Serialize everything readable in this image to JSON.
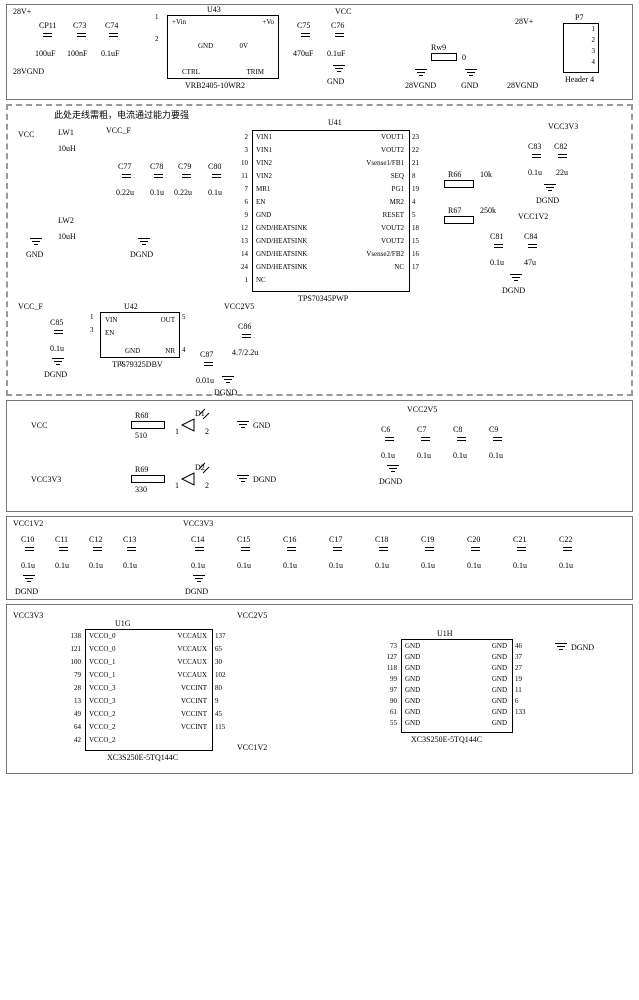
{
  "sec1": {
    "note": "",
    "p28v": "28V+",
    "p28vgnd": "28VGND",
    "cp11": {
      "ref": "CP11",
      "val": "100uF"
    },
    "c73": {
      "ref": "C73",
      "val": "100nF"
    },
    "c74": {
      "ref": "C74",
      "val": "0.1uF"
    },
    "u43": {
      "ref": "U43",
      "pn": "VRB2405-10WR2",
      "pins": {
        "vin": "+Vin",
        "vo": "+Vo",
        "gnd": "GND",
        "zv": "0V",
        "ctrl": "CTRL",
        "trim": "TRIM"
      },
      "num1": "1",
      "num2": "2"
    },
    "vcc": "VCC",
    "c75": {
      "ref": "C75",
      "val": "470uF"
    },
    "c76": {
      "ref": "C76",
      "val": "0.1uF"
    },
    "gnd": "GND",
    "rw9": {
      "ref": "Rw9",
      "val": "0"
    },
    "p7": {
      "ref": "P7",
      "pn": "Header 4",
      "pins": [
        "1",
        "2",
        "3",
        "4"
      ]
    }
  },
  "sec2": {
    "note": "此处走线需粗，电流通过能力要强",
    "vcc": "VCC",
    "vccf": "VCC_F",
    "gnd": "GND",
    "dgnd": "DGND",
    "lw1": {
      "ref": "LW1",
      "val": "10uH"
    },
    "lw2": {
      "ref": "LW2",
      "val": "10uH"
    },
    "c77": {
      "ref": "C77",
      "val": "0.22u"
    },
    "c78": {
      "ref": "C78",
      "val": "0.1u"
    },
    "c79": {
      "ref": "C79",
      "val": "0.22u"
    },
    "c80": {
      "ref": "C80",
      "val": "0.1u"
    },
    "u41": {
      "ref": "U41",
      "pn": "TPS70345PWP",
      "left": [
        "VIN1",
        "VIN1",
        "VIN2",
        "VIN2",
        "MR1",
        "EN",
        "GND",
        "GND/HEATSINK",
        "GND/HEATSINK",
        "GND/HEATSINK",
        "GND/HEATSINK",
        "NC"
      ],
      "lnum": [
        "2",
        "3",
        "10",
        "11",
        "7",
        "6",
        "9",
        "12",
        "13",
        "14",
        "24",
        "1"
      ],
      "right": [
        "VOUT1",
        "VOUT2",
        "Vsense1/FB1",
        "SEQ",
        "PG1",
        "MR2",
        "RESET",
        "VOUT2",
        "VOUT2",
        "Vsense2/FB2",
        "NC"
      ],
      "rnum": [
        "23",
        "22",
        "21",
        "8",
        "19",
        "4",
        "5",
        "18",
        "15",
        "16",
        "17"
      ]
    },
    "r66": {
      "ref": "R66",
      "val": "10k"
    },
    "r67": {
      "ref": "R67",
      "val": "250k"
    },
    "vcc3v3": "VCC3V3",
    "vcc1v2": "VCC1V2",
    "c82": {
      "ref": "C82",
      "val": "22u"
    },
    "c83": {
      "ref": "C83",
      "val": "0.1u"
    },
    "c81": {
      "ref": "C81",
      "val": "0.1u"
    },
    "c84": {
      "ref": "C84",
      "val": "47u"
    },
    "u42": {
      "ref": "U42",
      "pn": "TPS79325DBV",
      "pins": {
        "vin": "VIN",
        "en": "EN",
        "gnd": "GND",
        "out": "OUT",
        "nr": "NR"
      },
      "num": {
        "vin": "1",
        "en": "3",
        "gnd": "2",
        "out": "5",
        "nr": "4"
      }
    },
    "c85": {
      "ref": "C85",
      "val": "0.1u"
    },
    "c86": {
      "ref": "C86",
      "val": "4.7/2.2u"
    },
    "c87": {
      "ref": "C87",
      "val": "0.01u"
    },
    "vcc2v5": "VCC2V5"
  },
  "sec3": {
    "vcc": "VCC",
    "vcc3v3": "VCC3V3",
    "gnd": "GND",
    "dgnd": "DGND",
    "vcc2v5": "VCC2V5",
    "r68": {
      "ref": "R68",
      "val": "510"
    },
    "r69": {
      "ref": "R69",
      "val": "330"
    },
    "d1": {
      "ref": "D1",
      "a": "1",
      "k": "2"
    },
    "d2": {
      "ref": "D2",
      "a": "1",
      "k": "2"
    },
    "c6": {
      "ref": "C6",
      "val": "0.1u"
    },
    "c7": {
      "ref": "C7",
      "val": "0.1u"
    },
    "c8": {
      "ref": "C8",
      "val": "0.1u"
    },
    "c9": {
      "ref": "C9",
      "val": "0.1u"
    }
  },
  "sec4": {
    "vcc1v2": "VCC1V2",
    "vcc3v3": "VCC3V3",
    "dgnd": "DGND",
    "c10": {
      "ref": "C10",
      "val": "0.1u"
    },
    "c11": {
      "ref": "C11",
      "val": "0.1u"
    },
    "c12": {
      "ref": "C12",
      "val": "0.1u"
    },
    "c13": {
      "ref": "C13",
      "val": "0.1u"
    },
    "c14": {
      "ref": "C14",
      "val": "0.1u"
    },
    "c15": {
      "ref": "C15",
      "val": "0.1u"
    },
    "c16": {
      "ref": "C16",
      "val": "0.1u"
    },
    "c17": {
      "ref": "C17",
      "val": "0.1u"
    },
    "c18": {
      "ref": "C18",
      "val": "0.1u"
    },
    "c19": {
      "ref": "C19",
      "val": "0.1u"
    },
    "c20": {
      "ref": "C20",
      "val": "0.1u"
    },
    "c21": {
      "ref": "C21",
      "val": "0.1u"
    },
    "c22": {
      "ref": "C22",
      "val": "0.1u"
    }
  },
  "sec5": {
    "vcc3v3": "VCC3V3",
    "vcc2v5": "VCC2V5",
    "vcc1v2": "VCC1V2",
    "dgnd": "DGND",
    "u1g": {
      "ref": "U1G",
      "pn": "XC3S250E-5TQ144C",
      "left": [
        "VCCO_0",
        "VCCO_0",
        "VCCO_1",
        "VCCO_1",
        "VCCO_3",
        "VCCO_3",
        "VCCO_2",
        "VCCO_2",
        "VCCO_2"
      ],
      "lnum": [
        "138",
        "121",
        "100",
        "79",
        "28",
        "13",
        "49",
        "64",
        "42"
      ],
      "right": [
        "VCCAUX",
        "VCCAUX",
        "VCCAUX",
        "VCCAUX",
        "VCCINT",
        "VCCINT",
        "VCCINT",
        "VCCINT"
      ],
      "rnum": [
        "137",
        "65",
        "30",
        "102",
        "80",
        "9",
        "45",
        "115"
      ]
    },
    "u1h": {
      "ref": "U1H",
      "pn": "XC3S250E-5TQ144C",
      "left": [
        "GND",
        "GND",
        "GND",
        "GND",
        "GND",
        "GND",
        "GND",
        "GND"
      ],
      "lnum": [
        "73",
        "127",
        "118",
        "99",
        "97",
        "90",
        "61",
        "55"
      ],
      "right": [
        "GND",
        "GND",
        "GND",
        "GND",
        "GND",
        "GND",
        "GND",
        "GND"
      ],
      "rnum": [
        "46",
        "37",
        "27",
        "19",
        "11",
        "6",
        "133",
        ""
      ]
    }
  }
}
